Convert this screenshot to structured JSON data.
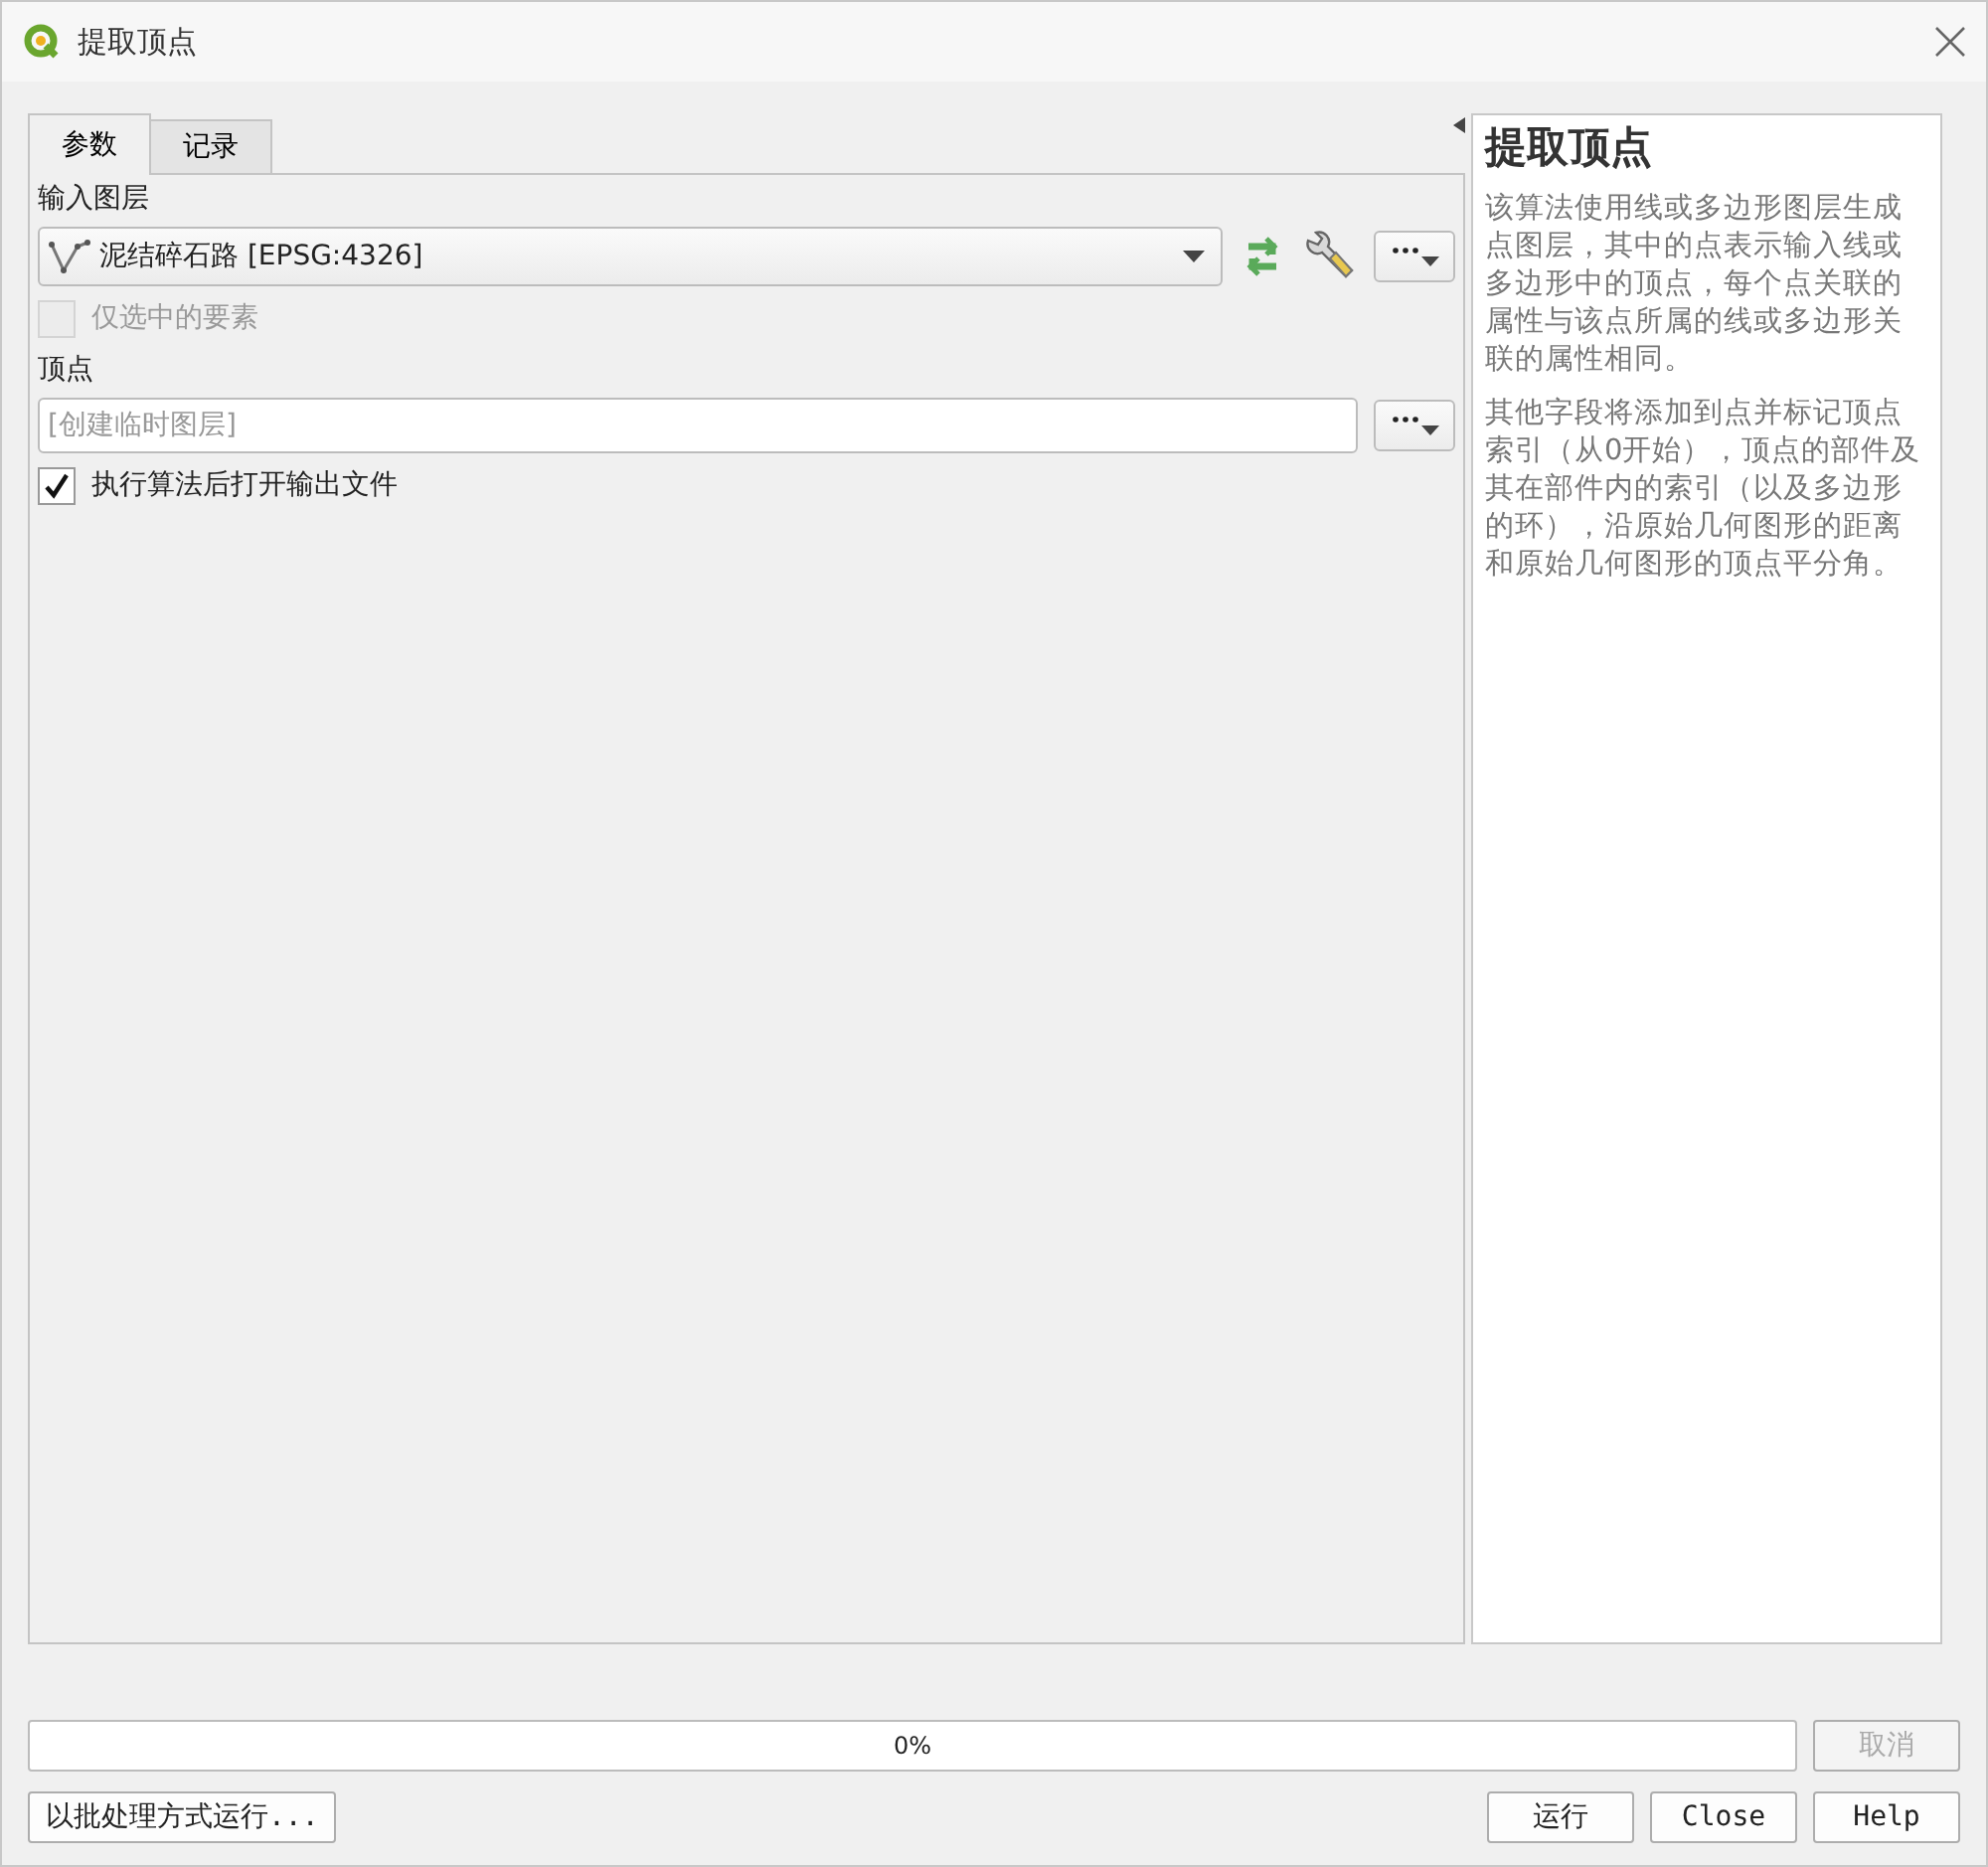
{
  "window": {
    "title": "提取顶点"
  },
  "tabs": [
    {
      "label": "参数",
      "selected": true
    },
    {
      "label": "记录",
      "selected": false
    }
  ],
  "parameters": {
    "input_layer": {
      "label": "输入图层",
      "value": "泥结碎石路 [EPSG:4326]"
    },
    "selected_only": {
      "label": "仅选中的要素",
      "checked": false,
      "disabled": true
    },
    "output": {
      "label": "顶点",
      "placeholder": "[创建临时图层]"
    },
    "open_output": {
      "label": "执行算法后打开输出文件",
      "checked": true,
      "disabled": false
    }
  },
  "help": {
    "title": "提取顶点",
    "paragraphs": [
      "该算法使用线或多边形图层生成点图层，其中的点表示输入线或多边形中的顶点，每个点关联的属性与该点所属的线或多边形关联的属性相同。",
      "其他字段将添加到点并标记顶点索引（从0开始），顶点的部件及其在部件内的索引（以及多边形的环），沿原始几何图形的距离和原始几何图形的顶点平分角。"
    ]
  },
  "progress": {
    "level": 0,
    "reading": "0%"
  },
  "cancel_button": {
    "label": "取消",
    "disabled": true
  },
  "batch_button": "以批处理方式运行...",
  "buttons": [
    "运行",
    "Close",
    "Help"
  ]
}
